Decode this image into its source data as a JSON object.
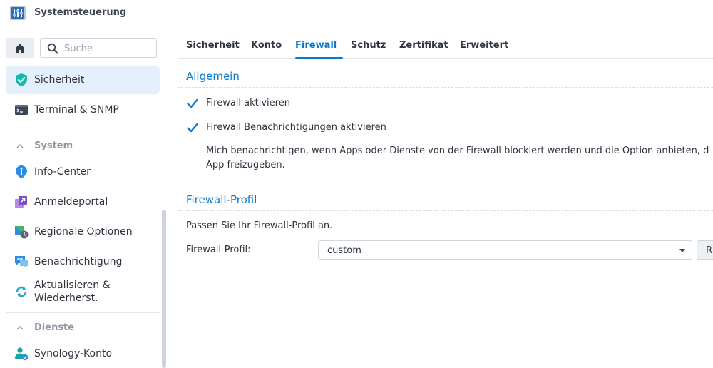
{
  "window": {
    "title": "Systemsteuerung"
  },
  "sidebar": {
    "search_placeholder": "Suche",
    "top_items": [
      {
        "label": "Sicherheit",
        "icon": "shield-icon",
        "active": true
      },
      {
        "label": "Terminal & SNMP",
        "icon": "terminal-icon"
      }
    ],
    "groups": [
      {
        "title": "System",
        "items": [
          {
            "label": "Info-Center",
            "icon": "info-icon"
          },
          {
            "label": "Anmeldeportal",
            "icon": "login-portal-icon"
          },
          {
            "label": "Regionale Optionen",
            "icon": "regional-options-icon"
          },
          {
            "label": "Benachrichtigung",
            "icon": "notification-icon"
          },
          {
            "label": "Aktualisieren & Wiederherst.",
            "line1": "Aktualisieren &",
            "line2": "Wiederherst.",
            "icon": "update-restore-icon"
          }
        ]
      },
      {
        "title": "Dienste",
        "items": [
          {
            "label": "Synology-Konto",
            "icon": "synology-account-icon"
          }
        ]
      }
    ]
  },
  "tabs": [
    {
      "label": "Sicherheit"
    },
    {
      "label": "Konto"
    },
    {
      "label": "Firewall",
      "active": true
    },
    {
      "label": "Schutz"
    },
    {
      "label": "Zertifikat"
    },
    {
      "label": "Erweitert"
    }
  ],
  "general": {
    "title": "Allgemein",
    "enable_firewall": {
      "label": "Firewall aktivieren",
      "checked": true
    },
    "enable_notifications": {
      "label": "Firewall Benachrichtigungen aktivieren",
      "checked": true
    },
    "description_line1": "Mich benachrichtigen, wenn Apps oder Dienste von der Firewall blockiert werden und die Option anbieten, d",
    "description_line2": "App freizugeben."
  },
  "profile": {
    "title": "Firewall-Profil",
    "instruction": "Passen Sie Ihr Firewall-Profil an.",
    "field_label": "Firewall-Profil:",
    "selected": "custom",
    "button_label": "R"
  },
  "colors": {
    "accent": "#0a7bd1",
    "active_bg": "#e4f0fb",
    "group_header": "#8d97a3"
  }
}
